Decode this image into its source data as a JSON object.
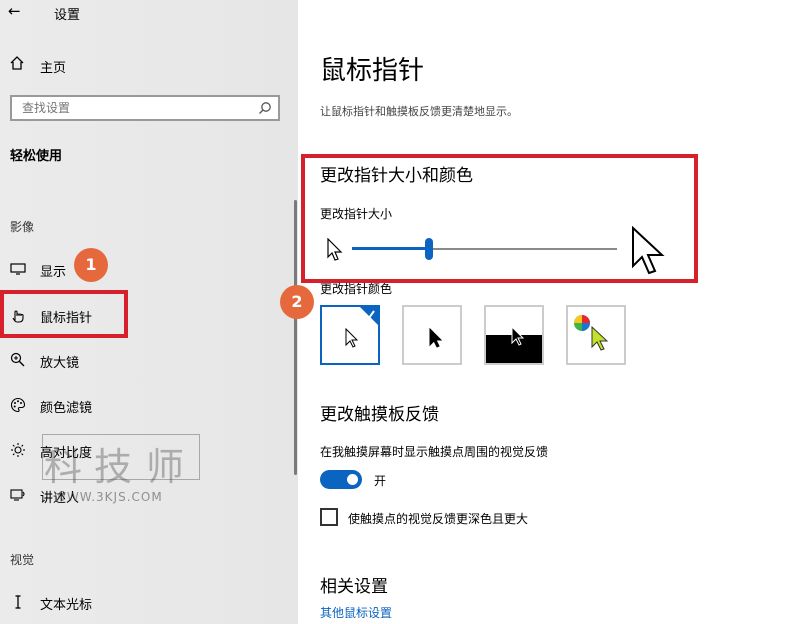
{
  "sidebar": {
    "back_glyph": "←",
    "window_title": "设置",
    "home_label": "主页",
    "search_placeholder": "查找设置",
    "section_title": "轻松使用",
    "groups": {
      "vision": "影像",
      "vision2": "视觉"
    },
    "items": [
      {
        "label": "显示",
        "icon": "monitor-icon"
      },
      {
        "label": "鼠标指针",
        "icon": "hand-pointer-icon"
      },
      {
        "label": "放大镜",
        "icon": "magnifier-plus-icon"
      },
      {
        "label": "颜色滤镜",
        "icon": "palette-icon"
      },
      {
        "label": "高对比度",
        "icon": "sun-contrast-icon"
      },
      {
        "label": "讲述人",
        "icon": "narrator-icon"
      },
      {
        "label": "文本光标",
        "icon": "text-cursor-icon"
      }
    ]
  },
  "callouts": [
    "1",
    "2"
  ],
  "main": {
    "title": "鼠标指针",
    "description": "让鼠标指针和触摸板反馈更清楚地显示。",
    "size_color_heading": "更改指针大小和颜色",
    "size_label": "更改指针大小",
    "size_value": 0.29,
    "color_label": "更改指针颜色",
    "color_options": [
      "white",
      "black",
      "inverted",
      "custom"
    ],
    "selected_color": "white",
    "touch_heading": "更改触摸板反馈",
    "touch_desc": "在我触摸屏幕时显示触摸点周围的视觉反馈",
    "toggle_state": "开",
    "checkbox_label": "使触摸点的视觉反馈更深色且更大",
    "related_heading": "相关设置",
    "related_link": "其他鼠标设置"
  },
  "watermark": {
    "chars": [
      "科",
      "技",
      "师"
    ],
    "url": "WWW.3KJS.COM"
  },
  "colors": {
    "accent": "#0a64c0",
    "highlight": "#d6202b",
    "callout": "#e6693e"
  }
}
